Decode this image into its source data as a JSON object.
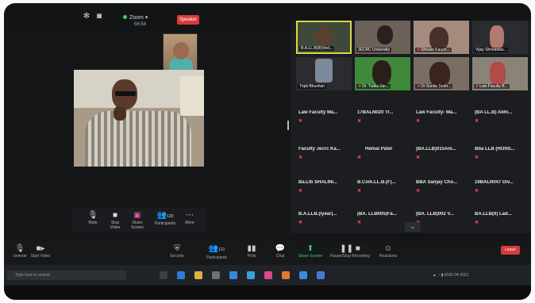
{
  "topbar": {
    "app_label": "Zoom",
    "time": "56:54",
    "speaker_view_label": "Speaker"
  },
  "controls": {
    "mute": "Mute",
    "stop_video": "Stop Video",
    "share": "Share Screen",
    "participants": "Participants",
    "participants_count": "120",
    "more": "More"
  },
  "video_tiles": [
    {
      "name": "B.A.LL.B(III)Ved..."
    },
    {
      "name": "JECRC University"
    },
    {
      "name": "Shivam Kaush..."
    },
    {
      "name": "Vijay Shrivastav..."
    },
    {
      "name": "Tripti Bhushan"
    },
    {
      "name": "Dr. Tulika Sin..."
    },
    {
      "name": "Dr Sunita Sedh..."
    },
    {
      "name": "Law Faculty B..."
    }
  ],
  "name_tiles": [
    {
      "name": "Law Faculty Ma..."
    },
    {
      "name": "17BALN020 Tr..."
    },
    {
      "name": "Law Faculty- Ma..."
    },
    {
      "name": "(BA LL.B) Abhi..."
    },
    {
      "name": "Faculty Jecrc Ka..."
    },
    {
      "name": "Hemal Patel"
    },
    {
      "name": "(BA.LLB)015Ani..."
    },
    {
      "name": "Bba LLB (HONS..."
    },
    {
      "name": "Ba.Llb SHALINI..."
    },
    {
      "name": "B.Com.LL.B.(F)..."
    },
    {
      "name": "BBA Sanjay Cho..."
    },
    {
      "name": "19BALN047 Div..."
    },
    {
      "name": "B.A.LLB.(Iyear)..."
    },
    {
      "name": "(BA. LLB005)Fa..."
    },
    {
      "name": "(BA. LLB)002 V..."
    },
    {
      "name": "BA.LLB(II) Lad..."
    }
  ],
  "toolbar": {
    "unmute": "Unmute",
    "start_video": "Start Video",
    "security": "Security",
    "participants": "Participants",
    "participants_count": "121",
    "polls": "Polls",
    "chat": "Chat",
    "share_screen": "Share Screen",
    "record": "Pause/Stop Recording",
    "reactions": "Reactions",
    "leave": "Leave"
  },
  "taskbar": {
    "search_placeholder": "Type here to search",
    "tray_text": "ENG 04-2021"
  },
  "colors": {
    "accent_green": "#3bd16f",
    "leave_red": "#d83b3b",
    "active_speaker": "#d9d84a"
  }
}
